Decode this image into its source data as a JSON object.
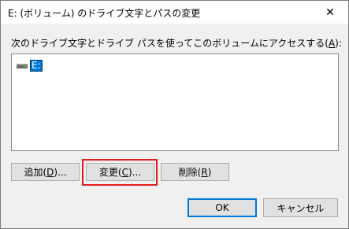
{
  "window": {
    "title": "E: (ボリューム) のドライブ文字とパスの変更",
    "close_label": "✕"
  },
  "instruction": {
    "text_before": "次のドライブ文字とドライブ パスを使ってこのボリュームにアクセスする(",
    "accel": "A",
    "text_after": "):"
  },
  "drive_list": {
    "items": [
      {
        "label": "E:",
        "icon": "drive-icon",
        "selected": true
      }
    ]
  },
  "buttons": {
    "add": {
      "text": "追加(",
      "accel": "D",
      "suffix": ")..."
    },
    "change": {
      "text": "変更(",
      "accel": "C",
      "suffix": ")..."
    },
    "remove": {
      "text": "削除(",
      "accel": "R",
      "suffix": ")"
    },
    "ok": "OK",
    "cancel": "キャンセル"
  },
  "colors": {
    "selection": "#0078d7",
    "highlight_frame": "#e21b1b"
  }
}
